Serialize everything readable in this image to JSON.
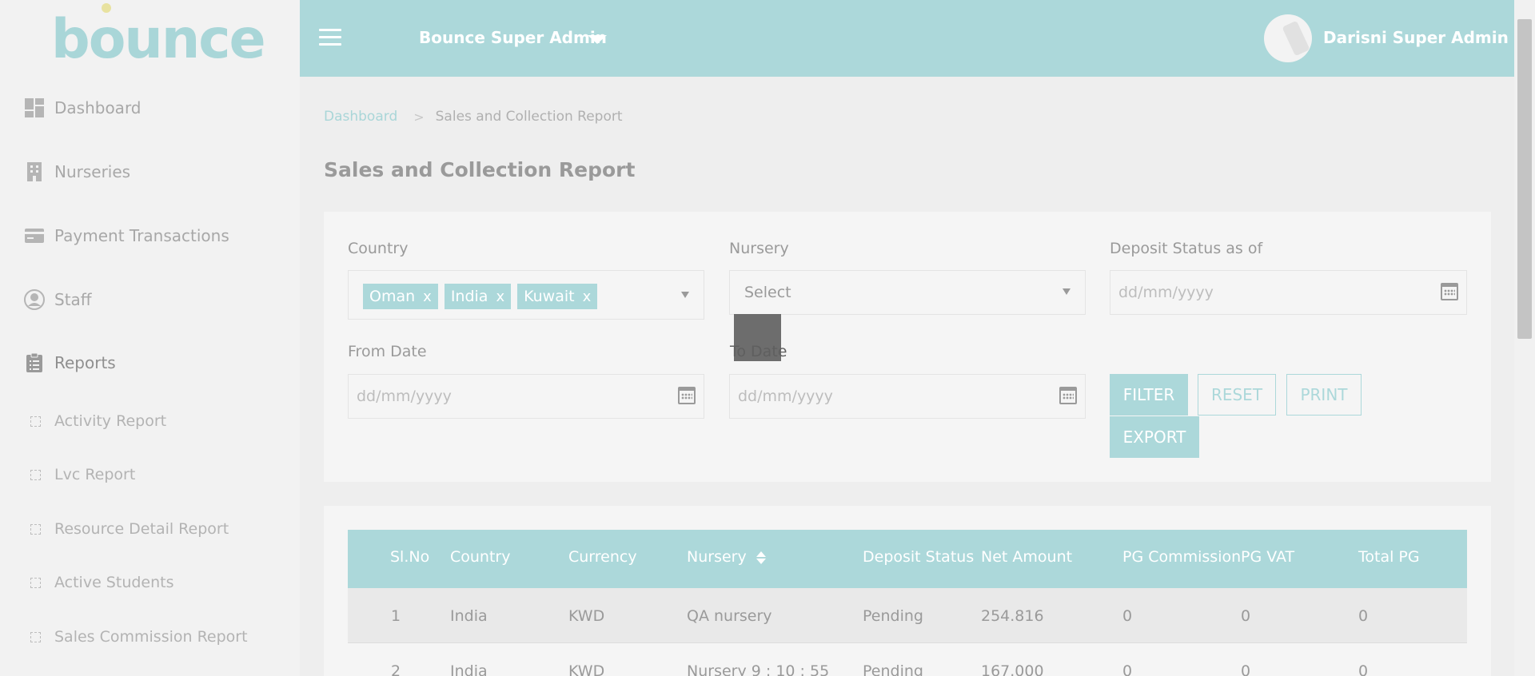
{
  "brand": {
    "logo_text_1": "b",
    "logo_text_2": "o",
    "logo_text_3": "unce",
    "accent": "#acd8da"
  },
  "sidebar": {
    "items": [
      {
        "label": "Dashboard",
        "icon": "dashboard-icon"
      },
      {
        "label": "Nurseries",
        "icon": "building-icon"
      },
      {
        "label": "Payment Transactions",
        "icon": "credit-card-icon"
      },
      {
        "label": "Staff",
        "icon": "user-circle-icon"
      },
      {
        "label": "Reports",
        "icon": "clipboard-icon"
      }
    ],
    "sub_items": [
      {
        "label": "Activity Report"
      },
      {
        "label": "Lvc Report"
      },
      {
        "label": "Resource Detail Report"
      },
      {
        "label": "Active Students"
      },
      {
        "label": "Sales Commission Report"
      }
    ]
  },
  "header": {
    "org_name": "Bounce Super Admin",
    "user_name": "Darisni Super Admin"
  },
  "breadcrumb": {
    "home": "Dashboard",
    "separator": ">",
    "current": "Sales and Collection Report"
  },
  "page": {
    "title": "Sales and Collection Report"
  },
  "filters": {
    "country": {
      "label": "Country",
      "chips": [
        "Oman",
        "India",
        "Kuwait"
      ],
      "chip_remove": "x"
    },
    "nursery": {
      "label": "Nursery",
      "value": "Select"
    },
    "deposit_status": {
      "label": "Deposit Status as of",
      "placeholder": "dd/mm/yyyy"
    },
    "from_date": {
      "label": "From Date",
      "placeholder": "dd/mm/yyyy"
    },
    "to_date": {
      "label": "To Date",
      "placeholder": "dd/mm/yyyy"
    },
    "buttons": {
      "filter": "FILTER",
      "reset": "RESET",
      "print": "PRINT",
      "export": "EXPORT"
    }
  },
  "table": {
    "headers": [
      "Sl.No",
      "Country",
      "Currency",
      "Nursery",
      "Deposit Status",
      "Net Amount",
      "PG Commission",
      "PG VAT",
      "Total PG"
    ],
    "rows": [
      [
        "1",
        "India",
        "KWD",
        "QA nursery",
        "Pending",
        "254.816",
        "0",
        "0",
        "0"
      ],
      [
        "2",
        "India",
        "KWD",
        "Nursery 9 : 10 : 55",
        "Pending",
        "167.000",
        "0",
        "0",
        "0"
      ]
    ]
  }
}
